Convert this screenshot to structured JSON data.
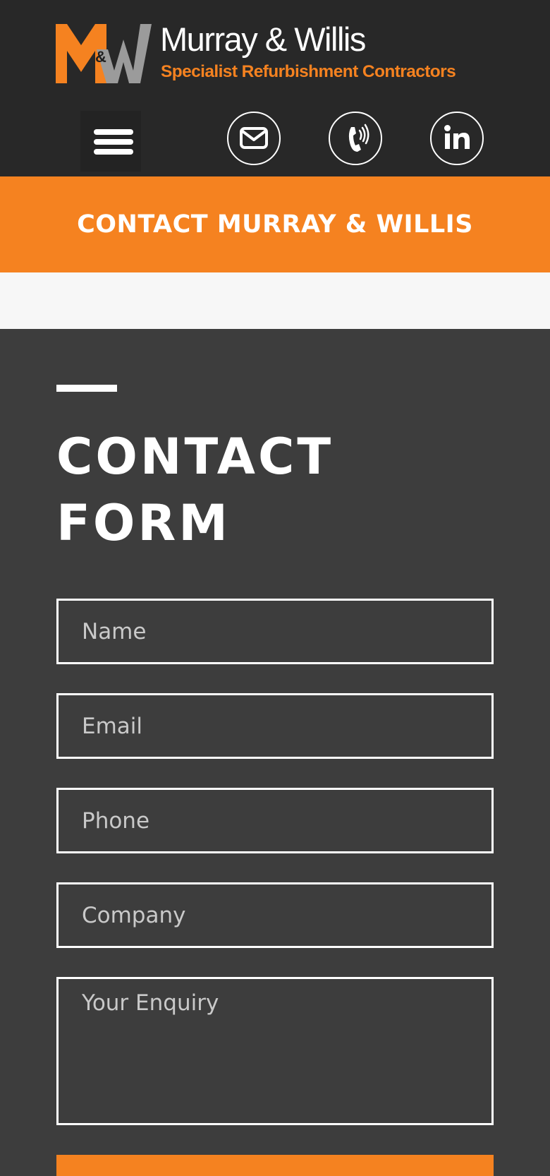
{
  "brand": {
    "mark_letter_left": "M",
    "mark_ampersand": "&",
    "mark_letter_right": "W",
    "name": "Murray & Willis",
    "tagline": "Specialist Refurbishment Contractors",
    "colors": {
      "orange": "#f58220",
      "grey": "#9b9b9b",
      "dark": "#282828"
    }
  },
  "header": {
    "menu_icon": "hamburger-menu-icon",
    "contact_icons": [
      "envelope-icon",
      "phone-icon",
      "linkedin-icon"
    ]
  },
  "banner": {
    "title": "CONTACT MURRAY & WILLIS"
  },
  "form": {
    "title": "CONTACT FORM",
    "name_placeholder": "Name",
    "email_placeholder": "Email",
    "phone_placeholder": "Phone",
    "company_placeholder": "Company",
    "enquiry_placeholder": "Your Enquiry"
  }
}
